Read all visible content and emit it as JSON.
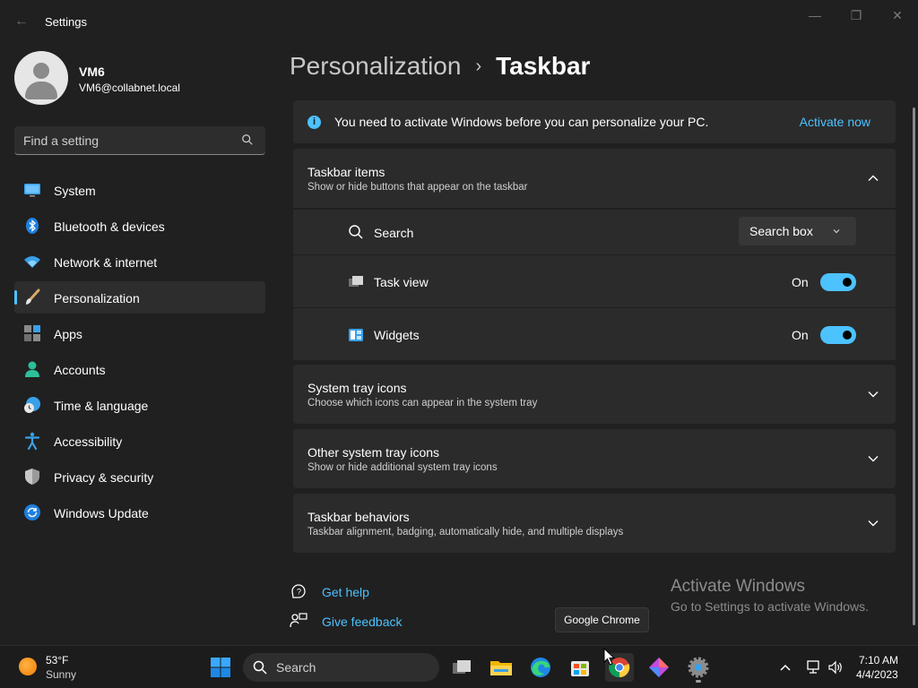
{
  "window": {
    "title": "Settings",
    "back_icon": "back-arrow-icon",
    "controls": [
      "minimize-icon",
      "maximize-icon",
      "close-icon"
    ]
  },
  "user": {
    "name": "VM6",
    "email": "VM6@collabnet.local"
  },
  "search": {
    "placeholder": "Find a setting"
  },
  "nav": {
    "items": [
      {
        "label": "System",
        "icon": "system-icon",
        "active": false
      },
      {
        "label": "Bluetooth & devices",
        "icon": "bluetooth-icon",
        "active": false
      },
      {
        "label": "Network & internet",
        "icon": "wifi-icon",
        "active": false
      },
      {
        "label": "Personalization",
        "icon": "paintbrush-icon",
        "active": true
      },
      {
        "label": "Apps",
        "icon": "apps-icon",
        "active": false
      },
      {
        "label": "Accounts",
        "icon": "accounts-icon",
        "active": false
      },
      {
        "label": "Time & language",
        "icon": "clock-globe-icon",
        "active": false
      },
      {
        "label": "Accessibility",
        "icon": "accessibility-icon",
        "active": false
      },
      {
        "label": "Privacy & security",
        "icon": "shield-icon",
        "active": false
      },
      {
        "label": "Windows Update",
        "icon": "update-icon",
        "active": false
      }
    ]
  },
  "breadcrumb": {
    "parent": "Personalization",
    "separator": "›",
    "current": "Taskbar"
  },
  "activation_bar": {
    "message": "You need to activate Windows before you can personalize your PC.",
    "link": "Activate now"
  },
  "groups": {
    "taskbar_items": {
      "title": "Taskbar items",
      "description": "Show or hide buttons that appear on the taskbar",
      "expanded": true,
      "rows": {
        "search": {
          "label": "Search",
          "value": "Search box"
        },
        "task_view": {
          "label": "Task view",
          "state": "On"
        },
        "widgets": {
          "label": "Widgets",
          "state": "On"
        }
      }
    },
    "system_tray": {
      "title": "System tray icons",
      "description": "Choose which icons can appear in the system tray"
    },
    "other_tray": {
      "title": "Other system tray icons",
      "description": "Show or hide additional system tray icons"
    },
    "behaviors": {
      "title": "Taskbar behaviors",
      "description": "Taskbar alignment, badging, automatically hide, and multiple displays"
    }
  },
  "help": {
    "get_help": "Get help",
    "give_feedback": "Give feedback"
  },
  "watermark": {
    "title": "Activate Windows",
    "subtitle": "Go to Settings to activate Windows."
  },
  "tooltip": "Google Chrome",
  "taskbar": {
    "weather": {
      "temp": "53°F",
      "condition": "Sunny"
    },
    "search_label": "Search",
    "apps": [
      "start-icon",
      "task-view-icon",
      "file-explorer-icon",
      "edge-icon",
      "store-icon",
      "chrome-icon",
      "copilot-icon",
      "settings-icon"
    ],
    "clock": {
      "time": "7:10 AM",
      "date": "4/4/2023"
    }
  },
  "colors": {
    "accent": "#4cc2ff",
    "background": "#202020",
    "card": "#2b2b2b"
  }
}
